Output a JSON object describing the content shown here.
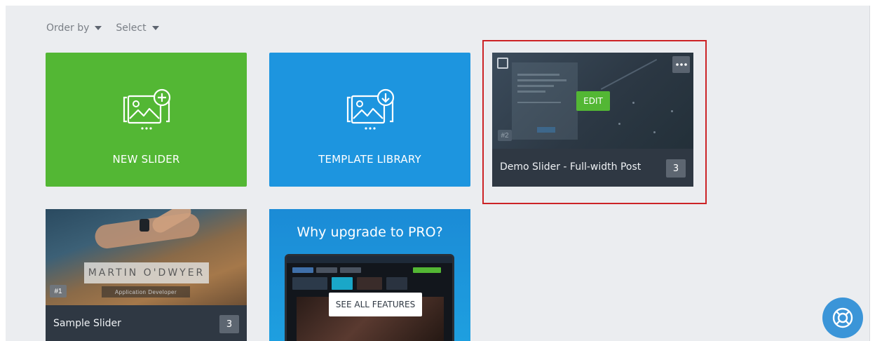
{
  "filters": {
    "order_by_label": "Order by",
    "select_label": "Select"
  },
  "tiles": {
    "new_slider_label": "NEW SLIDER",
    "template_library_label": "TEMPLATE LIBRARY"
  },
  "demo_slider": {
    "title": "Demo Slider - Full-width Post",
    "slide_count": "3",
    "edit_label": "EDIT",
    "id_badge": "#2"
  },
  "sample_slider": {
    "title": "Sample Slider",
    "slide_count": "3",
    "id_badge": "#1",
    "preview_name": "MARTIN O'DWYER",
    "preview_role": "Application Developer"
  },
  "pro_card": {
    "title": "Why upgrade to PRO?",
    "button_label": "SEE ALL FEATURES"
  },
  "help": {
    "icon": "lifebuoy-icon"
  },
  "colors": {
    "green": "#53b734",
    "blue": "#1d95df",
    "dark_card": "#2f3843",
    "highlight": "#cc2326",
    "background": "#ebedf0"
  }
}
